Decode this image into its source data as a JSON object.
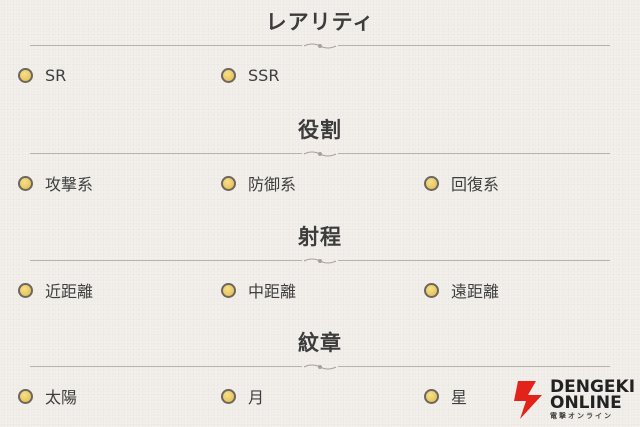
{
  "sections": [
    {
      "title": "レアリティ",
      "options": [
        "SR",
        "SSR"
      ]
    },
    {
      "title": "役割",
      "options": [
        "攻撃系",
        "防御系",
        "回復系"
      ]
    },
    {
      "title": "射程",
      "options": [
        "近距離",
        "中距離",
        "遠距離"
      ]
    },
    {
      "title": "紋章",
      "options": [
        "太陽",
        "月",
        "星"
      ]
    }
  ],
  "logo": {
    "line1": "DENGEKI",
    "line2": "ONLINE",
    "line3": "電撃オンライン"
  },
  "colors": {
    "dot": "#e8c55a",
    "dot_ring": "#6d6660",
    "divider": "#b9b2aa",
    "background": "#f3f0ec"
  }
}
